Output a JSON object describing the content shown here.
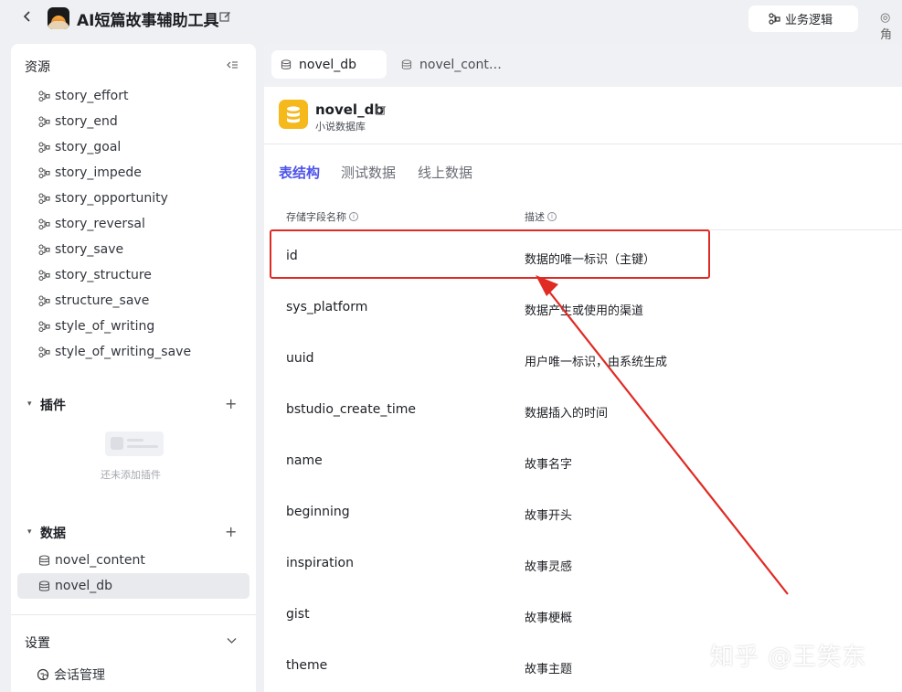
{
  "header": {
    "app_title": "AI短篇故事辅助工具",
    "tab_logic": "业务逻辑",
    "tab_next": "角"
  },
  "sidebar": {
    "resources_title": "资源",
    "resources": [
      "story_effort",
      "story_end",
      "story_goal",
      "story_impede",
      "story_opportunity",
      "story_reversal",
      "story_save",
      "story_structure",
      "structure_save",
      "style_of_writing",
      "style_of_writing_save"
    ],
    "plugins_title": "插件",
    "plugins_empty": "还未添加插件",
    "data_title": "数据",
    "data_items": [
      "novel_content",
      "novel_db"
    ],
    "settings_title": "设置",
    "settings_item": "会话管理"
  },
  "main": {
    "tabs": [
      "novel_db",
      "novel_cont…"
    ],
    "db_name": "novel_db",
    "db_desc": "小说数据库",
    "subtabs": [
      "表结构",
      "测试数据",
      "线上数据"
    ],
    "col_field": "存储字段名称",
    "col_desc": "描述",
    "rows": [
      {
        "field": "id",
        "desc": "数据的唯一标识（主键）"
      },
      {
        "field": "sys_platform",
        "desc": "数据产生或使用的渠道"
      },
      {
        "field": "uuid",
        "desc": "用户唯一标识，由系统生成"
      },
      {
        "field": "bstudio_create_time",
        "desc": "数据插入的时间"
      },
      {
        "field": "name",
        "desc": "故事名字"
      },
      {
        "field": "beginning",
        "desc": "故事开头"
      },
      {
        "field": "inspiration",
        "desc": "故事灵感"
      },
      {
        "field": "gist",
        "desc": "故事梗概"
      },
      {
        "field": "theme",
        "desc": "故事主题"
      }
    ]
  },
  "watermark": "知乎 @王笑东",
  "colors": {
    "accent": "#4d53e8",
    "db_icon": "#f5b91c",
    "annotation": "#e02a24"
  }
}
